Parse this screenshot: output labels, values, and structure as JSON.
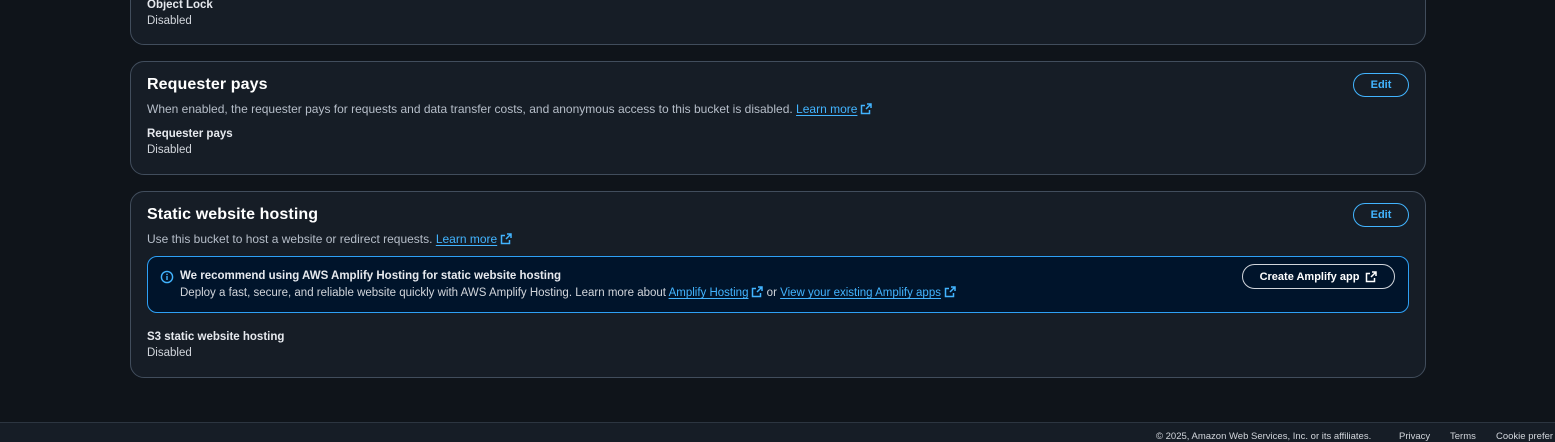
{
  "object_lock": {
    "label": "Object Lock",
    "value": "Disabled"
  },
  "requester_pays": {
    "title": "Requester pays",
    "description": "When enabled, the requester pays for requests and data transfer costs, and anonymous access to this bucket is disabled.",
    "learn_more": "Learn more",
    "edit_label": "Edit",
    "field_label": "Requester pays",
    "field_value": "Disabled"
  },
  "static_hosting": {
    "title": "Static website hosting",
    "description": "Use this bucket to host a website or redirect requests.",
    "learn_more": "Learn more",
    "edit_label": "Edit",
    "alert": {
      "title": "We recommend using AWS Amplify Hosting for static website hosting",
      "body_prefix": "Deploy a fast, secure, and reliable website quickly with AWS Amplify Hosting. Learn more about",
      "link1": "Amplify Hosting",
      "joiner": "or",
      "link2": "View your existing Amplify apps",
      "button_label": "Create Amplify app"
    },
    "field_label": "S3 static website hosting",
    "field_value": "Disabled"
  },
  "footer": {
    "copyright": "© 2025, Amazon Web Services, Inc. or its affiliates.",
    "privacy": "Privacy",
    "terms": "Terms",
    "cookies": "Cookie prefer"
  },
  "colors": {
    "background": "#0f141a",
    "card": "#161d26",
    "accent": "#42b4ff",
    "info_bg": "#00142b"
  },
  "icons": {
    "external": "external-link-icon",
    "info": "info-icon"
  }
}
